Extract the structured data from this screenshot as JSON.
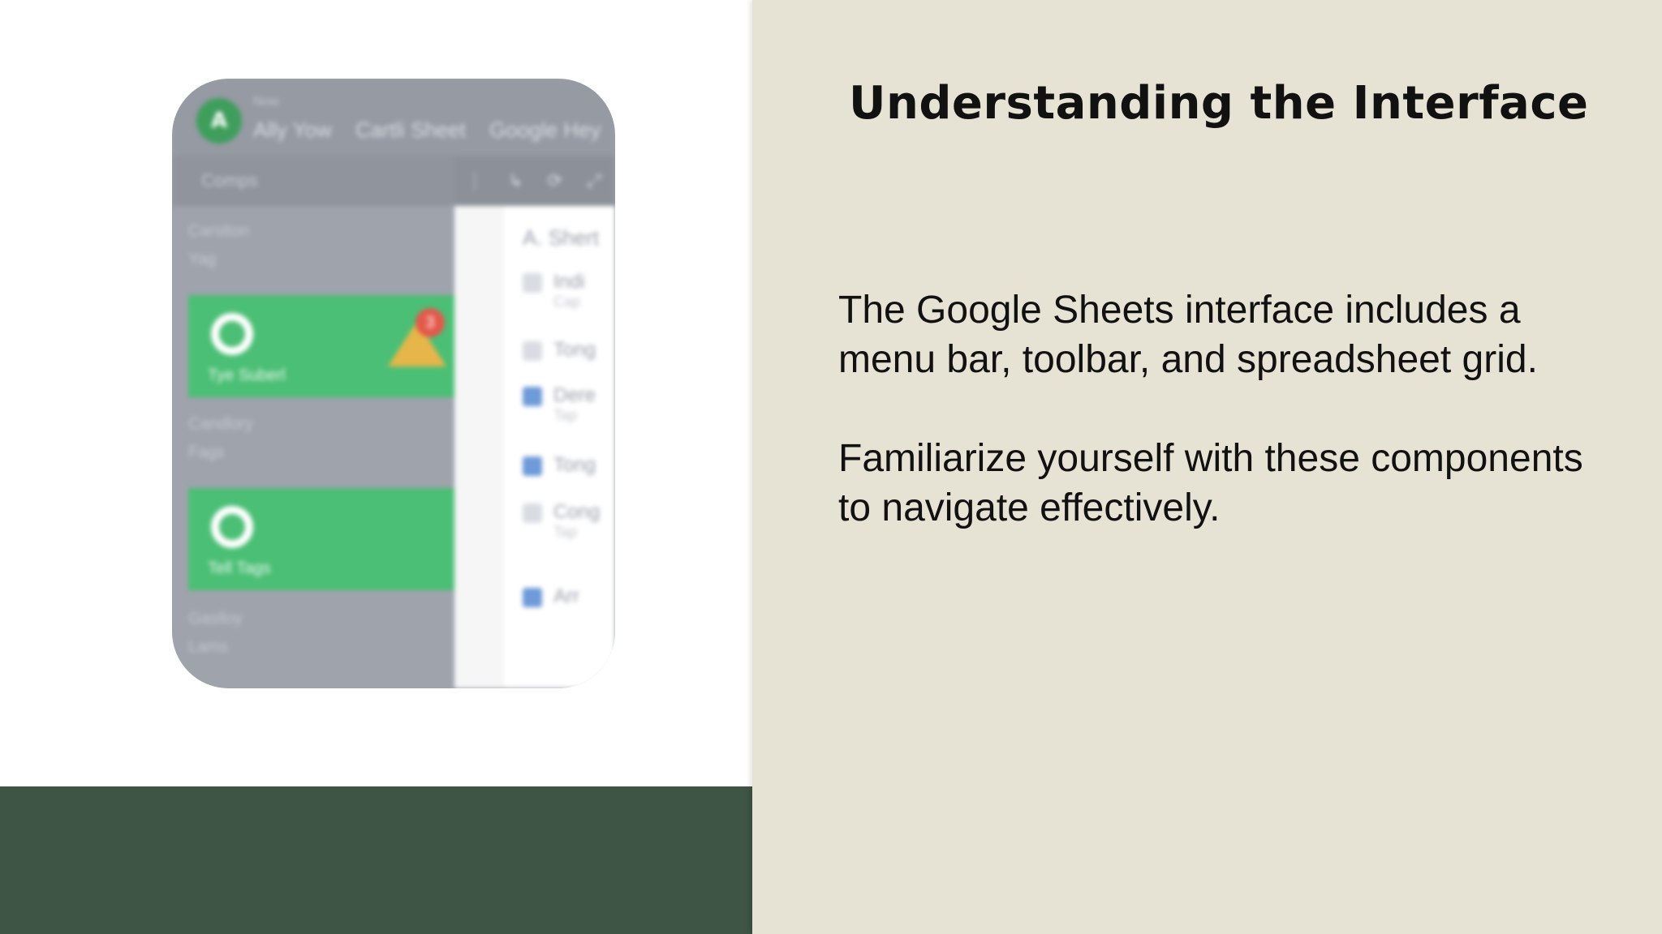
{
  "slide": {
    "title": "Understanding the Interface",
    "paragraphs": [
      "The Google Sheets interface includes a menu bar, toolbar, and spreadsheet grid.",
      "Familiarize yourself with these components to navigate effectively."
    ]
  },
  "colors": {
    "right_panel": "#e7e3d4",
    "bottom_band": "#3e5444",
    "text": "#111111",
    "thumbnail_green": "#4bbf75"
  },
  "thumbnail": {
    "avatar_letter": "A",
    "top_line": "Now",
    "breadcrumbs": [
      "Ally Yow",
      "Cartli Sheet",
      "Google Hey"
    ],
    "sidebar_top": "Comps",
    "sidebar_items": [
      {
        "title": "Carstton",
        "sub": "Yag"
      },
      {
        "title": "Candlory",
        "sub": "Fags"
      },
      {
        "title": "Gaslloy",
        "sub": "Lams"
      }
    ],
    "green_items": [
      "Tye Suberl",
      "Tell Tags"
    ],
    "badge_count": "3",
    "main_header": "A. Shert",
    "main_rows": [
      {
        "label": "Indi",
        "sub": "Cap"
      },
      {
        "label": "Tong",
        "sub": ""
      },
      {
        "label": "Dere",
        "sub": "Tap"
      },
      {
        "label": "Tong",
        "sub": ""
      },
      {
        "label": "Cong",
        "sub": "Tap"
      },
      {
        "label": "Arr",
        "sub": ""
      }
    ],
    "icons": [
      "gear-icon",
      "warning-icon",
      "folder-icon",
      "share-icon",
      "tag-icon",
      "person-icon"
    ]
  }
}
